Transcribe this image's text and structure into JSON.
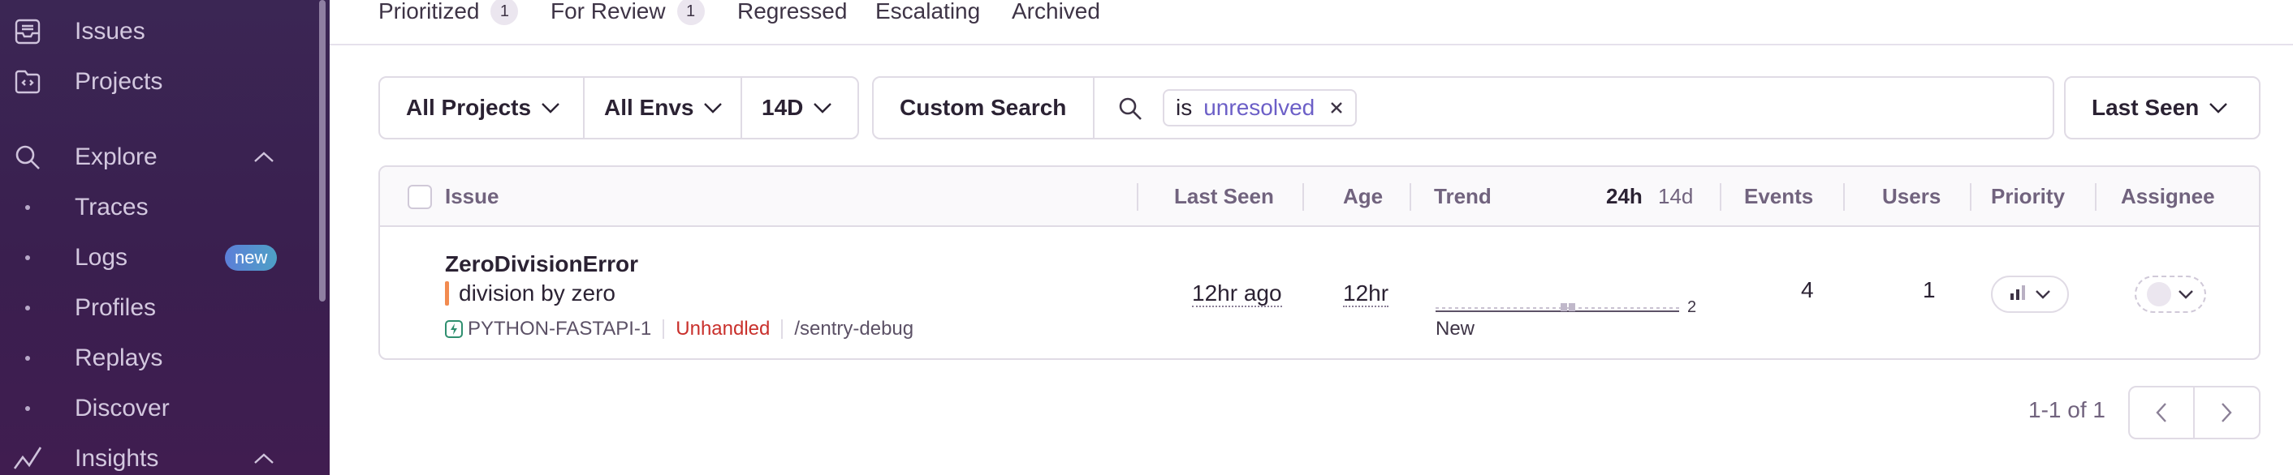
{
  "sidebar": {
    "items": [
      {
        "label": "Issues",
        "icon": "inbox-icon"
      },
      {
        "label": "Projects",
        "icon": "code-folder-icon"
      }
    ],
    "explore": {
      "label": "Explore",
      "icon": "search-icon",
      "items": [
        {
          "label": "Traces"
        },
        {
          "label": "Logs",
          "badge": "new"
        },
        {
          "label": "Profiles"
        },
        {
          "label": "Replays"
        },
        {
          "label": "Discover"
        }
      ]
    },
    "insights": {
      "label": "Insights",
      "icon": "line-chart-icon"
    }
  },
  "tabs": [
    {
      "label": "Prioritized",
      "count": "1"
    },
    {
      "label": "For Review",
      "count": "1"
    },
    {
      "label": "Regressed"
    },
    {
      "label": "Escalating"
    },
    {
      "label": "Archived"
    }
  ],
  "filters": {
    "project": "All Projects",
    "environment": "All Envs",
    "period": "14D",
    "custom_search": "Custom Search",
    "token_key": "is",
    "token_value": "unresolved",
    "sort": "Last Seen"
  },
  "table": {
    "headers": {
      "issue": "Issue",
      "last_seen": "Last Seen",
      "age": "Age",
      "trend": "Trend",
      "trend_24h": "24h",
      "trend_14d": "14d",
      "events": "Events",
      "users": "Users",
      "priority": "Priority",
      "assignee": "Assignee"
    },
    "rows": [
      {
        "title": "ZeroDivisionError",
        "message": "division by zero",
        "short_id": "PYTHON-FASTAPI-1",
        "handled": "Unhandled",
        "culprit": "/sentry-debug",
        "last_seen": "12hr ago",
        "age": "12hr",
        "trend_max": "2",
        "trend_label": "New",
        "events": "4",
        "users": "1"
      }
    ]
  },
  "pagination": {
    "text": "1-1 of 1"
  },
  "colors": {
    "sidebar_bg": "#3b2654",
    "accent": "#6c5fc7",
    "unhandled": "#c9302c",
    "message_bar": "#f28b50",
    "new_badge": "#5c7fd8"
  }
}
